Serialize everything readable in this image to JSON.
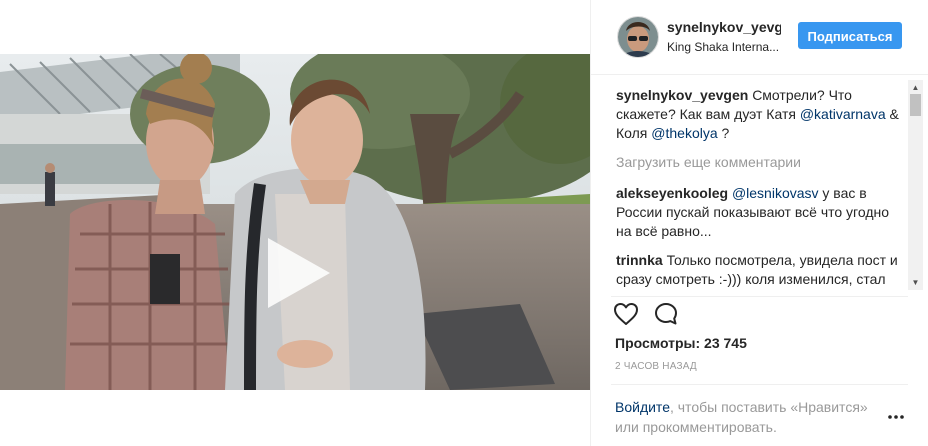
{
  "post": {
    "username": "synelnykov_yevgen",
    "location": "King Shaka Interna...",
    "follow_label": "Подписаться"
  },
  "comments": [
    {
      "user": "synelnykov_yevgen",
      "parts": [
        {
          "type": "text",
          "value": "Смотрели? Что скажете? Как вам дуэт Катя "
        },
        {
          "type": "mention",
          "value": "@kativarnava"
        },
        {
          "type": "text",
          "value": " & Коля "
        },
        {
          "type": "mention",
          "value": "@thekolya"
        },
        {
          "type": "text",
          "value": " ?"
        }
      ]
    },
    {
      "user": "alekseyenkooleg",
      "parts": [
        {
          "type": "mention",
          "value": "@lesnikovasv"
        },
        {
          "type": "text",
          "value": " у вас в России пускай показывают всё что угодно на всё равно..."
        }
      ]
    },
    {
      "user": "trinnka",
      "parts": [
        {
          "type": "text",
          "value": "Только посмотрела, увидела пост и сразу смотреть :-))) коля изменился, стал получше, интереснее. От кати"
        }
      ]
    }
  ],
  "load_more_label": "Загрузить еще комментарии",
  "views_label": "Просмотры: 23 745",
  "time_label": "2 часов назад",
  "login": {
    "link": "Войдите",
    "rest": ", чтобы поставить «Нравится» или прокомментировать."
  },
  "icons": {
    "like": "heart-outline-icon",
    "comment": "speech-bubble-icon",
    "play": "play-icon",
    "more": "ellipsis-icon"
  },
  "colors": {
    "accent": "#3897f0",
    "mention": "#003569",
    "muted": "#999999",
    "text": "#262626"
  }
}
